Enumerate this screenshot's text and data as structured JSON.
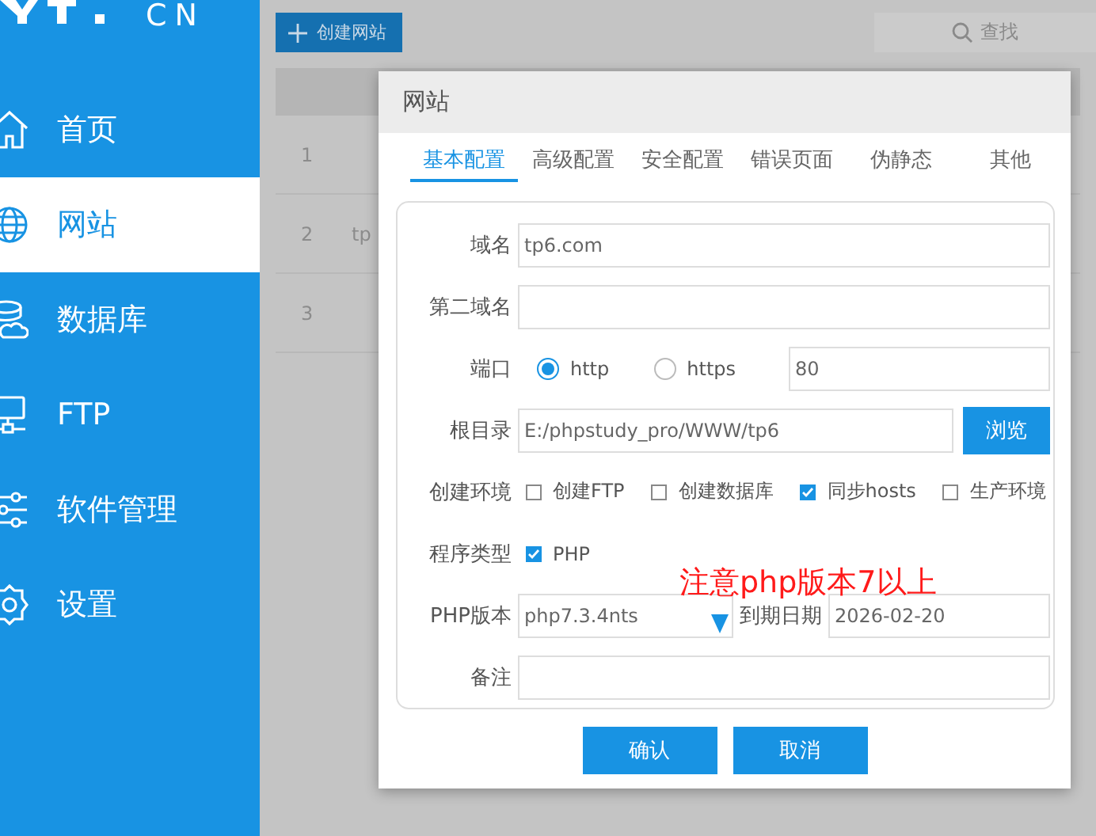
{
  "sidebar": {
    "logo": "CN",
    "items": [
      {
        "kind": "house",
        "label": "首页",
        "selected": false
      },
      {
        "kind": "globe",
        "label": "网站",
        "selected": true
      },
      {
        "kind": "database",
        "label": "数据库",
        "selected": false
      },
      {
        "kind": "monitor",
        "label": "FTP",
        "selected": false
      },
      {
        "kind": "sliders",
        "label": "软件管理",
        "selected": false
      },
      {
        "kind": "gear",
        "label": "设置",
        "selected": false
      }
    ]
  },
  "toolbar": {
    "create_button": "创建网站",
    "search_placeholder": "查找"
  },
  "table": {
    "rows": [
      {
        "index": "1"
      },
      {
        "index": "2",
        "column_2": "tp"
      },
      {
        "index": "3"
      }
    ]
  },
  "dialog": {
    "title": "网站",
    "tabs": [
      {
        "label": "基本配置",
        "selected": true
      },
      {
        "label": "高级配置",
        "selected": false
      },
      {
        "label": "安全配置",
        "selected": false
      },
      {
        "label": "错误页面",
        "selected": false
      },
      {
        "label": "伪静态",
        "selected": false
      },
      {
        "label": "其他",
        "selected": false
      }
    ],
    "fields": [
      {
        "kind": "text",
        "label": "域名",
        "value": "tp6.com"
      },
      {
        "kind": "text",
        "label": "第二域名"
      },
      {
        "kind": "port",
        "label": "端口",
        "options": [
          {
            "label": "http",
            "selected": true
          },
          {
            "label": "https",
            "selected": false
          }
        ],
        "value": "80"
      },
      {
        "kind": "path",
        "label": "根目录",
        "value": "E:/phpstudy_pro/WWW/tp6",
        "button": "浏览"
      },
      {
        "kind": "checks",
        "label": "创建环境",
        "options": [
          {
            "label": "创建FTP",
            "checked": false
          },
          {
            "label": "创建数据库",
            "checked": false
          },
          {
            "label": "同步hosts",
            "checked": true
          },
          {
            "label": "生产环境",
            "checked": false
          }
        ]
      },
      {
        "kind": "checks",
        "label": "程序类型",
        "options": [
          {
            "label": "PHP",
            "checked": true
          }
        ]
      },
      {
        "kind": "version",
        "label": "PHP版本",
        "value": "php7.3.4nts",
        "date_label": "到期日期",
        "date_value": "2026-02-20"
      },
      {
        "kind": "text",
        "label": "备注"
      }
    ],
    "buttons": [
      "确认",
      "取消"
    ],
    "annotation": "注意php版本7以上"
  }
}
